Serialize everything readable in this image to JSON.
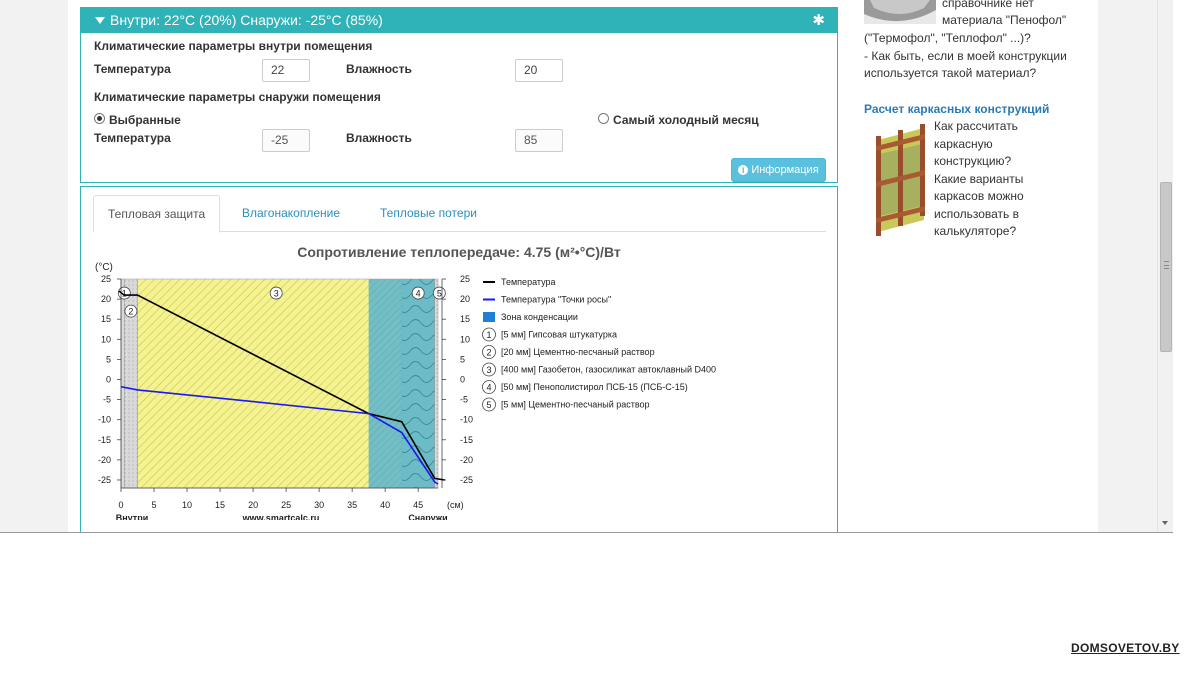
{
  "climate": {
    "header": "Внутри: 22°C (20%) Снаружи: -25°C (85%)",
    "inside_title": "Климатические параметры внутри помещения",
    "temperature_label": "Температура",
    "humidity_label": "Влажность",
    "inside_temp": "22",
    "inside_humidity": "20",
    "outside_title": "Климатические параметры снаружи помещения",
    "radio_selected_label": "Выбранные",
    "radio_coldest_label": "Самый холодный месяц",
    "outside_temp": "-25",
    "outside_humidity": "85",
    "info_button": "Информация"
  },
  "tabs": [
    {
      "label": "Тепловая защита",
      "active": true
    },
    {
      "label": "Влагонакопление",
      "active": false
    },
    {
      "label": "Тепловые потери",
      "active": false
    }
  ],
  "result_title": "Сопротивление теплопередаче: 4.75 (м²•°С)/Вт",
  "chart_data": {
    "type": "line",
    "title": "",
    "ylabel": "(°С)",
    "xlabel": "(см)",
    "ylim": [
      -27,
      25
    ],
    "xlim": [
      0,
      48
    ],
    "y_ticks": [
      25,
      20,
      15,
      10,
      5,
      0,
      -5,
      -10,
      -15,
      -20,
      -25
    ],
    "x_ticks": [
      0,
      5,
      10,
      15,
      20,
      25,
      30,
      35,
      40,
      45
    ],
    "inside_label": "Внутри",
    "outside_label": "Снаружи",
    "site_label": "www.smartcalc.ru",
    "layers": [
      {
        "num": "1",
        "from": 0,
        "to": 0.5,
        "color": "#d4d4d4"
      },
      {
        "num": "2",
        "from": 0.5,
        "to": 2.5,
        "color": "#c9c9c9"
      },
      {
        "num": "3",
        "from": 2.5,
        "to": 42.5,
        "color": "#f2f28e"
      },
      {
        "num": "4",
        "from": 42.5,
        "to": 47.5,
        "color": "#66b9c6"
      },
      {
        "num": "5",
        "from": 47.5,
        "to": 48,
        "color": "#c9c9c9"
      }
    ],
    "condensation_zone": {
      "from": 37.5,
      "to": 47.5,
      "color": "#66b9c6"
    },
    "series": [
      {
        "name": "Температура",
        "color": "#000000",
        "x": [
          -0.5,
          0.5,
          2.5,
          37.5,
          42.5,
          47.5,
          49
        ],
        "y": [
          22,
          21,
          21,
          -8.5,
          -10.5,
          -24.6,
          -25
        ]
      },
      {
        "name": "Температура \"Точки росы\"",
        "color": "#1a1aee",
        "x": [
          0,
          2.5,
          20,
          37.5,
          42.5,
          47.5,
          48
        ],
        "y": [
          -1.8,
          -2.6,
          -5.5,
          -8.5,
          -13.2,
          -25.5,
          -26
        ]
      }
    ],
    "legend": [
      {
        "label": "Температура",
        "kind": "line",
        "color": "#000000"
      },
      {
        "label": "Температура \"Точки росы\"",
        "kind": "line",
        "color": "#1a1aee"
      },
      {
        "label": "Зона конденсации",
        "kind": "box",
        "color": "#1f7fd6"
      },
      {
        "label": "[5 мм] Гипсовая штукатурка",
        "kind": "num",
        "num": "1"
      },
      {
        "label": "[20 мм] Цементно-песчаный раствор",
        "kind": "num",
        "num": "2"
      },
      {
        "label": "[400 мм] Газобетон, газосиликат автоклавный D400",
        "kind": "num",
        "num": "3"
      },
      {
        "label": "[50 мм] Пенополистирол ПСБ-15 (ПСБ-С-15)",
        "kind": "num",
        "num": "4"
      },
      {
        "label": "[5 мм] Цементно-песчаный раствор",
        "kind": "num",
        "num": "5"
      }
    ]
  },
  "sidebar": {
    "top_line": "справочнике нет",
    "top_line2": "материала \"Пенофол\"",
    "top_line3": "(\"Термофол\", \"Теплофол\" ...)?",
    "top_line4": "- Как быть, если в моей конструкции",
    "top_line5": "используется такой материал?",
    "frame_link": "Расчет каркасных конструкций",
    "frame_text": [
      "Как рассчитать",
      "каркасную",
      "конструкцию?",
      "Какие варианты",
      "каркасов можно",
      "использовать в",
      "калькуляторе?"
    ]
  },
  "watermark": "DOMSOVETOV.BY"
}
